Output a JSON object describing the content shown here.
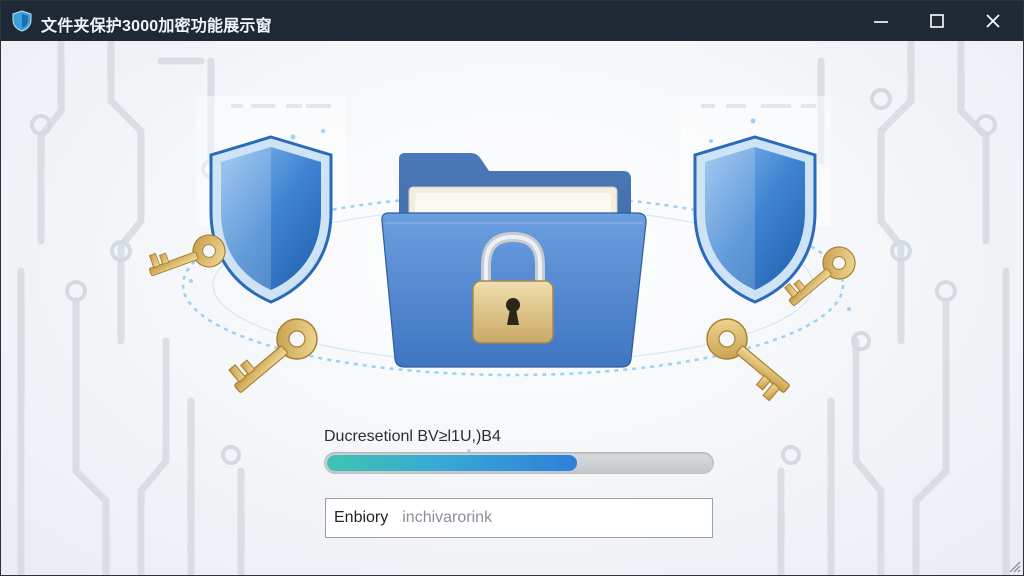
{
  "window": {
    "title": "文件夹保护3000加密功能展示窗",
    "controls": {
      "minimize_icon": "minimize-icon",
      "maximize_icon": "maximize-icon",
      "close_icon": "close-icon"
    }
  },
  "colors": {
    "titlebar": "#1f2835",
    "folder": "#4f86cc",
    "shield": "#3d7fd0",
    "key": "#d9b866",
    "progress_start": "#3fc3b2",
    "progress_end": "#2e7fd8"
  },
  "status": {
    "label": "Ducresetionl BV≥l1U,)B4",
    "progress_fraction": 0.65
  },
  "input": {
    "label": "Enbiory",
    "value": "inchivarorink"
  },
  "illustration": {
    "center_icon": "locked-folder-icon",
    "side_icons": [
      "shield-icon",
      "shield-icon"
    ],
    "key_icons": [
      "key-icon",
      "key-icon",
      "key-icon",
      "key-icon"
    ]
  }
}
